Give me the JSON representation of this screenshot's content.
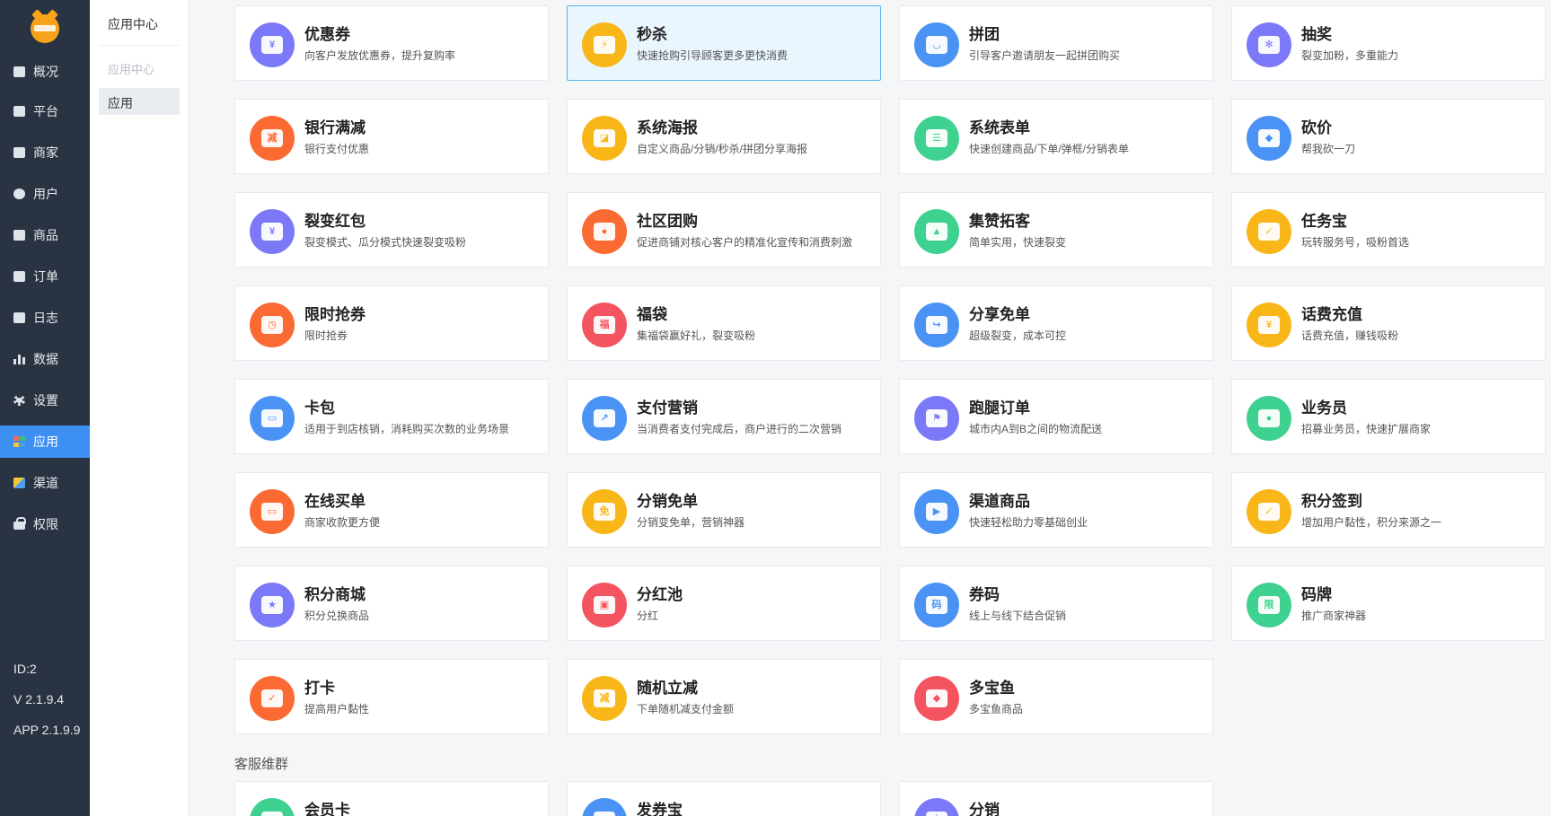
{
  "nav": {
    "items": [
      {
        "label": "概况",
        "icon": "dashboard-icon"
      },
      {
        "label": "平台",
        "icon": "monitor-icon"
      },
      {
        "label": "商家",
        "icon": "store-icon"
      },
      {
        "label": "用户",
        "icon": "user-icon"
      },
      {
        "label": "商品",
        "icon": "goods-icon"
      },
      {
        "label": "订单",
        "icon": "order-icon"
      },
      {
        "label": "日志",
        "icon": "log-icon"
      },
      {
        "label": "数据",
        "icon": "bar-chart-icon"
      },
      {
        "label": "设置",
        "icon": "gear-icon"
      },
      {
        "label": "应用",
        "icon": "apps-icon"
      },
      {
        "label": "渠道",
        "icon": "cube-icon"
      },
      {
        "label": "权限",
        "icon": "lock-icon"
      }
    ],
    "id_text": "ID:2",
    "version": "V 2.1.9.4",
    "app_version": "APP 2.1.9.9"
  },
  "sub": {
    "title": "应用中心",
    "group": "应用中心",
    "item": "应用"
  },
  "colors": {
    "nav_bg": "#2a3342",
    "nav_active": "#3d8ff2",
    "card_active_bg": "#eaf6fd",
    "card_active_border": "#55b6ec"
  },
  "apps": [
    {
      "title": "优惠券",
      "desc": "向客户发放优惠券，提升复购率",
      "icon": "coupon-icon",
      "color": "#7b79f7",
      "glyph": "¥"
    },
    {
      "title": "秒杀",
      "desc": "快速抢购引导顾客更多更快消费",
      "icon": "flash-sale-icon",
      "color": "#f9b618",
      "glyph": "⚡",
      "active": true
    },
    {
      "title": "拼团",
      "desc": "引导客户邀请朋友一起拼团购买",
      "icon": "group-buy-icon",
      "color": "#4a93f5",
      "glyph": "◡"
    },
    {
      "title": "抽奖",
      "desc": "裂变加粉，多重能力",
      "icon": "lottery-wheel-icon",
      "color": "#7b79f7",
      "glyph": "✻"
    },
    {
      "title": "银行满减",
      "desc": "银行支付优惠",
      "icon": "bank-discount-icon",
      "color": "#fb6a33",
      "glyph": "减"
    },
    {
      "title": "系统海报",
      "desc": "自定义商品/分销/秒杀/拼团分享海报",
      "icon": "poster-icon",
      "color": "#f9b618",
      "glyph": "◪"
    },
    {
      "title": "系统表单",
      "desc": "快速创建商品/下单/弹框/分销表单",
      "icon": "form-icon",
      "color": "#3fd18f",
      "glyph": "☰"
    },
    {
      "title": "砍价",
      "desc": "帮我砍一刀",
      "icon": "bargain-tag-icon",
      "color": "#4a93f5",
      "glyph": "◆"
    },
    {
      "title": "裂变红包",
      "desc": "裂变模式、瓜分模式快速裂变吸粉",
      "icon": "red-envelope-icon",
      "color": "#7b79f7",
      "glyph": "¥"
    },
    {
      "title": "社区团购",
      "desc": "促进商铺对核心客户的精准化宣传和消费刺激",
      "icon": "community-group-icon",
      "color": "#fb6a33",
      "glyph": "●"
    },
    {
      "title": "集赞拓客",
      "desc": "简单实用，快速裂变",
      "icon": "thumbs-up-icon",
      "color": "#3fd18f",
      "glyph": "▲"
    },
    {
      "title": "任务宝",
      "desc": "玩转服务号，吸粉首选",
      "icon": "task-clipboard-icon",
      "color": "#f9b618",
      "glyph": "✓"
    },
    {
      "title": "限时抢券",
      "desc": "限时抢券",
      "icon": "timer-icon",
      "color": "#fb6a33",
      "glyph": "◷"
    },
    {
      "title": "福袋",
      "desc": "集福袋赢好礼，裂变吸粉",
      "icon": "lucky-bag-icon",
      "color": "#f4545f",
      "glyph": "福"
    },
    {
      "title": "分享免单",
      "desc": "超级裂变，成本可控",
      "icon": "share-free-icon",
      "color": "#4a93f5",
      "glyph": "↪"
    },
    {
      "title": "话费充值",
      "desc": "话费充值，赚钱吸粉",
      "icon": "phone-recharge-icon",
      "color": "#f9b618",
      "glyph": "¥"
    },
    {
      "title": "卡包",
      "desc": "适用于到店核销，消耗购买次数的业务场景",
      "icon": "card-wallet-icon",
      "color": "#4a93f5",
      "glyph": "▭"
    },
    {
      "title": "支付营销",
      "desc": "当消费者支付完成后，商户进行的二次营销",
      "icon": "payment-growth-icon",
      "color": "#4a93f5",
      "glyph": "↗"
    },
    {
      "title": "跑腿订单",
      "desc": "城市内A到B之间的物流配送",
      "icon": "courier-scooter-icon",
      "color": "#7b79f7",
      "glyph": "⚑"
    },
    {
      "title": "业务员",
      "desc": "招募业务员，快速扩展商家",
      "icon": "salesman-icon",
      "color": "#3fd18f",
      "glyph": "●"
    },
    {
      "title": "在线买单",
      "desc": "商家收款更方便",
      "icon": "wallet-icon",
      "color": "#fb6a33",
      "glyph": "▭"
    },
    {
      "title": "分销免单",
      "desc": "分销变免单，营销神器",
      "icon": "free-ticket-icon",
      "color": "#f9b618",
      "glyph": "免"
    },
    {
      "title": "渠道商品",
      "desc": "快速轻松助力零基础创业",
      "icon": "channel-play-icon",
      "color": "#4a93f5",
      "glyph": "▶"
    },
    {
      "title": "积分签到",
      "desc": "增加用户黏性，积分来源之一",
      "icon": "checkin-calendar-icon",
      "color": "#f9b618",
      "glyph": "✓"
    },
    {
      "title": "积分商城",
      "desc": "积分兑换商品",
      "icon": "points-mall-icon",
      "color": "#7b79f7",
      "glyph": "★"
    },
    {
      "title": "分红池",
      "desc": "分红",
      "icon": "dividend-pool-icon",
      "color": "#f4545f",
      "glyph": "▣"
    },
    {
      "title": "券码",
      "desc": "线上与线下结合促销",
      "icon": "voucher-code-icon",
      "color": "#4a93f5",
      "glyph": "码"
    },
    {
      "title": "码牌",
      "desc": "推广商家神器",
      "icon": "code-plate-icon",
      "color": "#3fd18f",
      "glyph": "限"
    },
    {
      "title": "打卡",
      "desc": "提高用户黏性",
      "icon": "punch-calendar-icon",
      "color": "#fb6a33",
      "glyph": "✓"
    },
    {
      "title": "随机立减",
      "desc": "下单随机减支付金额",
      "icon": "random-discount-icon",
      "color": "#f9b618",
      "glyph": "减"
    },
    {
      "title": "多宝鱼",
      "desc": "多宝鱼商品",
      "icon": "duobaoyu-icon",
      "color": "#f4545f",
      "glyph": "◆"
    }
  ],
  "section2": {
    "title": "客服维群",
    "apps": [
      {
        "title": "会员卡",
        "icon": "member-card-icon",
        "color": "#3fd18f",
        "glyph": "▬"
      },
      {
        "title": "发券宝",
        "icon": "coupon-sender-icon",
        "color": "#4a93f5",
        "glyph": "▤"
      },
      {
        "title": "分销",
        "icon": "distribution-icon",
        "color": "#7b79f7",
        "glyph": "┼"
      }
    ]
  }
}
